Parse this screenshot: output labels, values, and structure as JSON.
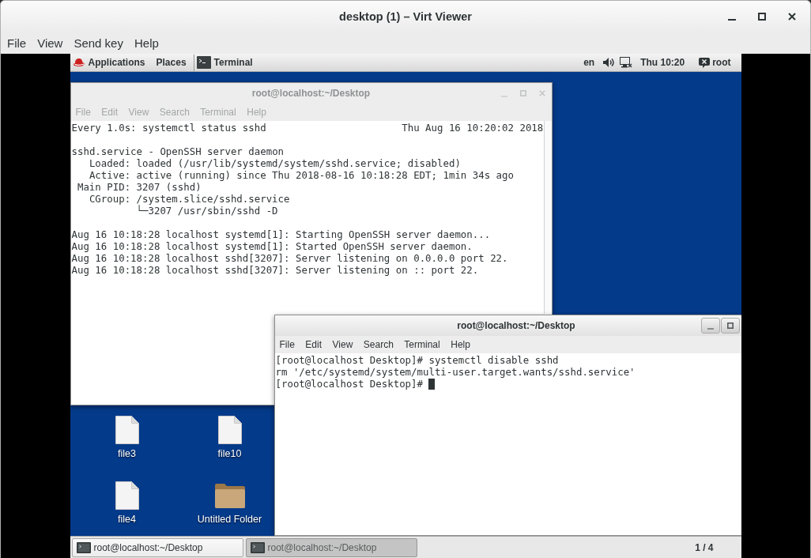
{
  "window": {
    "title": "desktop (1) – Virt Viewer"
  },
  "menu": [
    {
      "label": "File"
    },
    {
      "label": "View"
    },
    {
      "label": "Send key"
    },
    {
      "label": "Help"
    }
  ],
  "top_bar": {
    "applications": "Applications",
    "places": "Places",
    "app": "Terminal",
    "language": "en",
    "clock": "Thu 10:20",
    "user": "root"
  },
  "windows": [
    {
      "kind": "watch",
      "title": "root@localhost:~/Desktop",
      "focused": false,
      "menu": [
        "File",
        "Edit",
        "View",
        "Search",
        "Terminal",
        "Help"
      ],
      "header": {
        "command": "Every 1.0s: systemctl status sshd",
        "timestamp": "Thu Aug 16 10:20:02 2018"
      },
      "unit": {
        "title": "sshd.service - OpenSSH server daemon",
        "fields": [
          {
            "label": "Loaded:",
            "value": "loaded (/usr/lib/systemd/system/sshd.service; disabled)"
          },
          {
            "label": "Active:",
            "value": "active (running) since Thu 2018-08-16 10:18:28 EDT; 1min 34s ago"
          },
          {
            "label": "Main PID:",
            "value": "3207 (sshd)"
          },
          {
            "label": "CGroup:",
            "value": "/system.slice/sshd.service",
            "children": [
              {
                "value": "└─3207 /usr/sbin/sshd -D"
              }
            ]
          }
        ]
      },
      "log": [
        "Aug 16 10:18:28 localhost systemd[1]: Starting OpenSSH server daemon...",
        "Aug 16 10:18:28 localhost systemd[1]: Started OpenSSH server daemon.",
        "Aug 16 10:18:28 localhost sshd[3207]: Server listening on 0.0.0.0 port 22.",
        "Aug 16 10:18:28 localhost sshd[3207]: Server listening on :: port 22."
      ]
    },
    {
      "kind": "shell",
      "title": "root@localhost:~/Desktop",
      "focused": true,
      "menu": [
        "File",
        "Edit",
        "View",
        "Search",
        "Terminal",
        "Help"
      ],
      "lines": [
        {
          "text": "[root@localhost Desktop]# systemctl disable sshd",
          "cursor": false
        },
        {
          "text": "rm '/etc/systemd/system/multi-user.target.wants/sshd.service'",
          "cursor": false
        },
        {
          "text": "[root@localhost Desktop]#",
          "cursor": true
        }
      ]
    }
  ],
  "desktop_icons": [
    {
      "kind": "file",
      "label": "file3"
    },
    {
      "kind": "file",
      "label": "file10"
    },
    {
      "kind": "file",
      "label": "file4"
    },
    {
      "kind": "folder",
      "label": "Untitled Folder"
    }
  ],
  "taskbar": {
    "tasks": [
      {
        "label": "root@localhost:~/Desktop",
        "selected": false
      },
      {
        "label": "root@localhost:~/Desktop",
        "selected": true
      }
    ],
    "workspace": "1 / 4"
  }
}
